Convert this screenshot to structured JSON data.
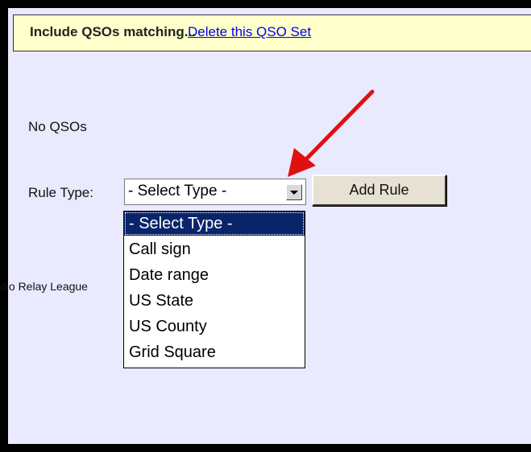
{
  "header": {
    "title": "Include QSOs matching...",
    "delete_link": "Delete this QSO Set"
  },
  "status": {
    "no_qsos": "No QSOs"
  },
  "rule": {
    "label": "Rule Type:",
    "select_value": "- Select Type -",
    "add_button": "Add Rule"
  },
  "dropdown": {
    "options": [
      "- Select Type -",
      "Call sign",
      "Date range",
      "US State",
      "US County",
      "Grid Square"
    ]
  },
  "footer": {
    "text": "dio Relay League"
  },
  "annotation": {
    "arrow_color": "#e01010"
  },
  "colors": {
    "header_bg": "#ffffcc",
    "panel_bg": "#eaeaff",
    "selection_bg": "#0a246a",
    "link": "#0000ee"
  }
}
